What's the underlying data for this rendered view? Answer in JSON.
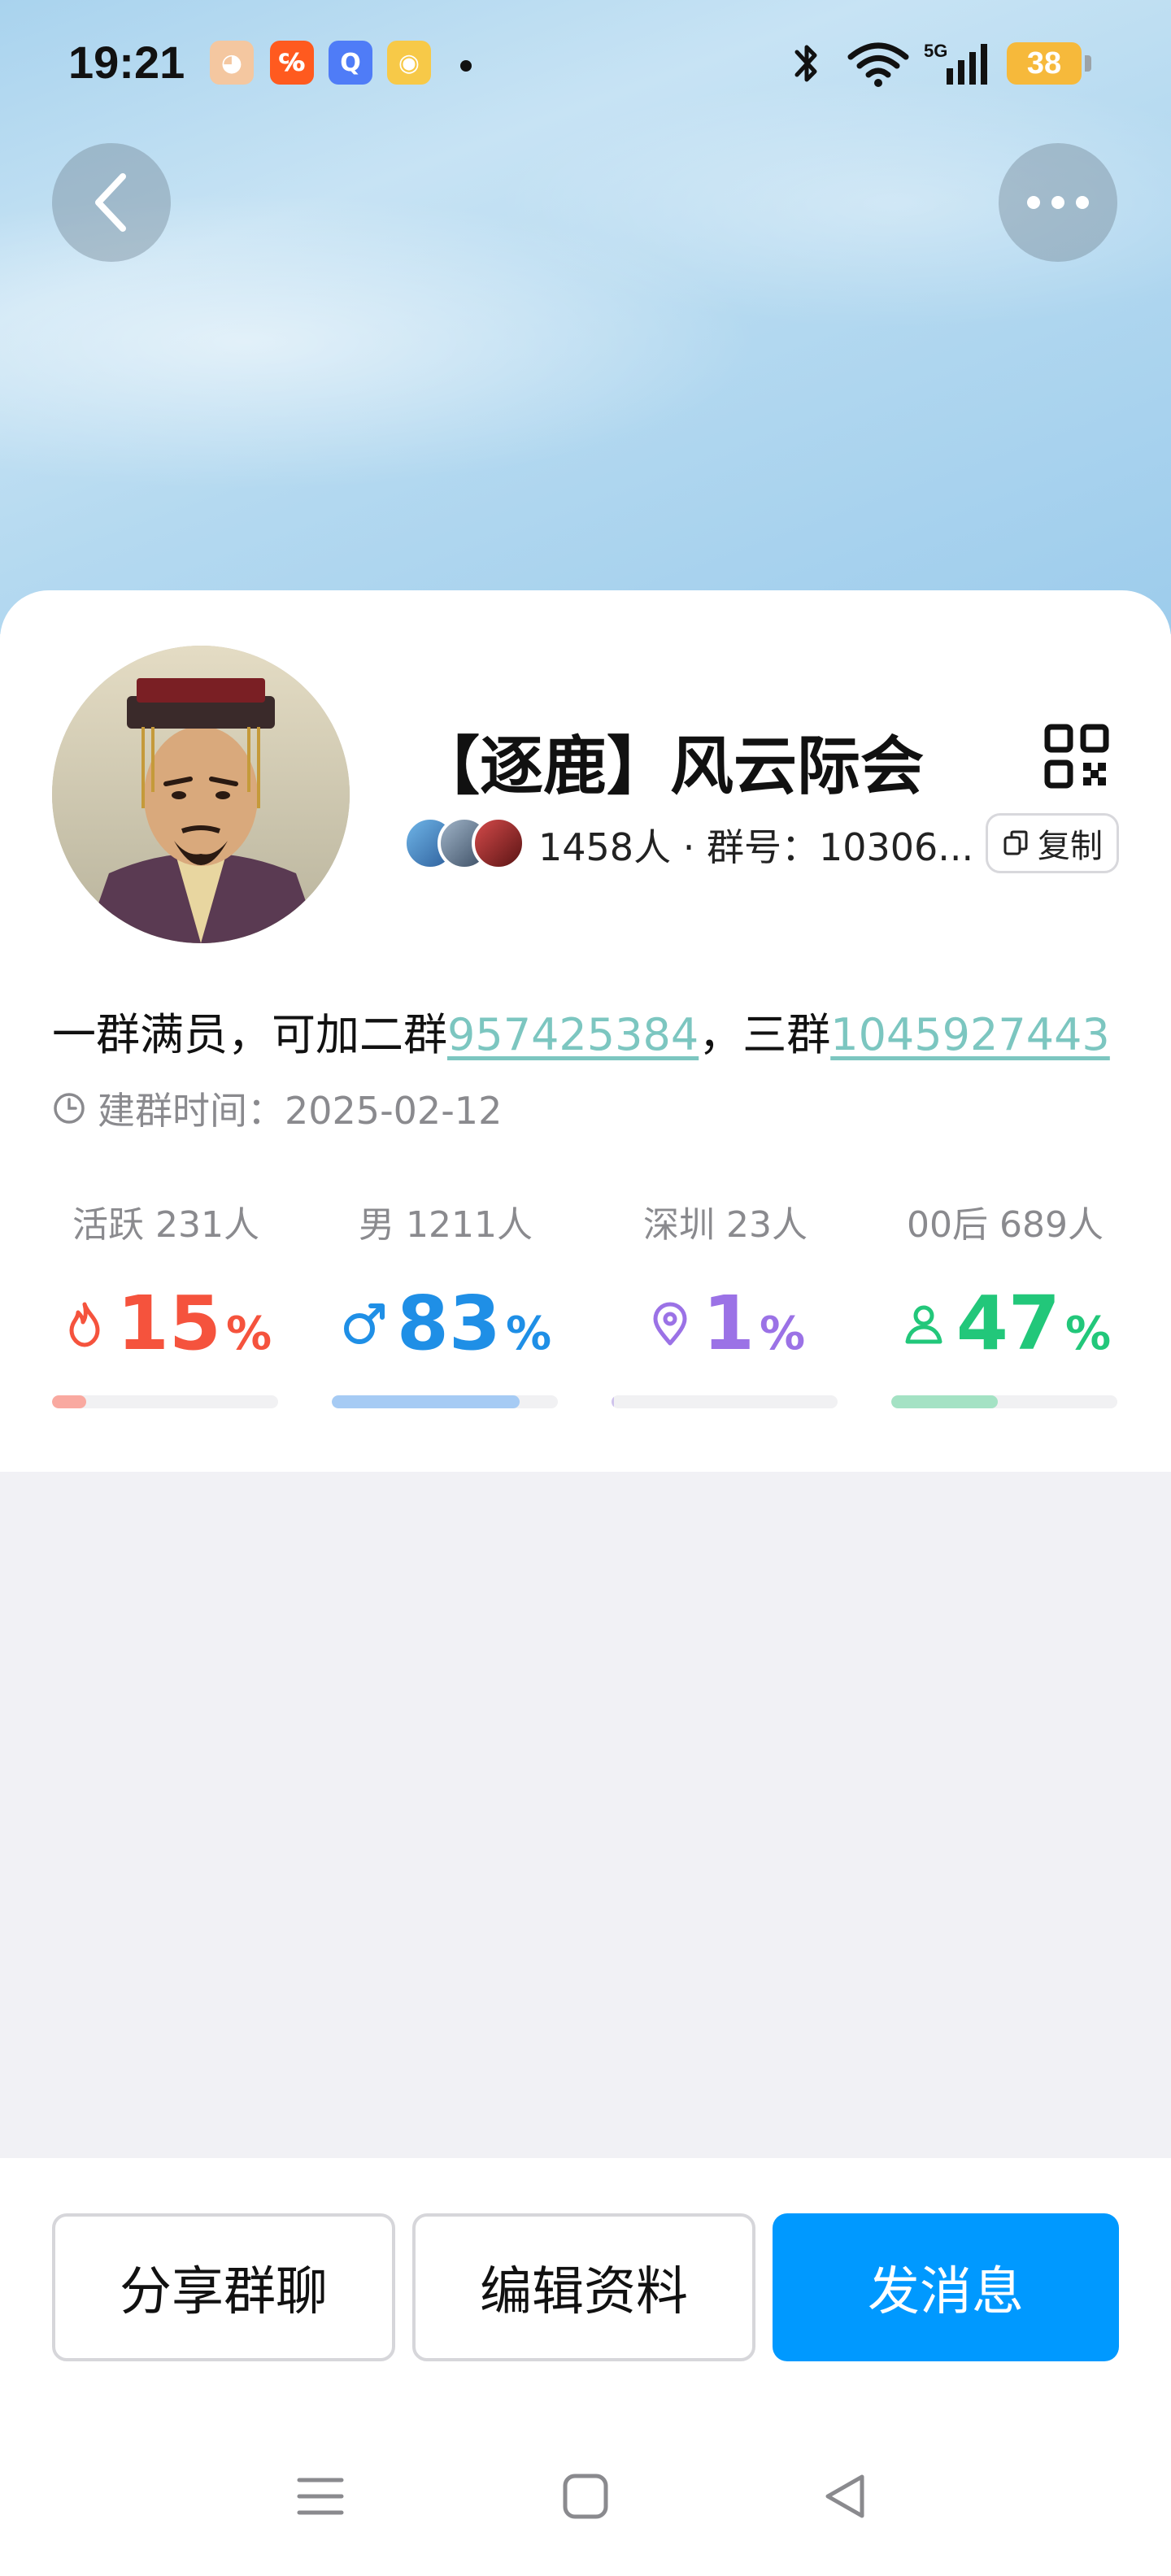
{
  "status_bar": {
    "time": "19:21",
    "battery": "38",
    "network": "5G",
    "notifications": [
      {
        "name": "app-notification-1-icon",
        "color": "#f4c7a0",
        "glyph": "◕"
      },
      {
        "name": "app-notification-2-icon",
        "color": "#ff5a1f",
        "glyph": "℅"
      },
      {
        "name": "app-notification-3-icon",
        "color": "#4f7cf7",
        "glyph": "Q"
      },
      {
        "name": "weibo-icon",
        "color": "#f7c948",
        "glyph": "◉"
      }
    ]
  },
  "header": {
    "back_icon": "chevron-left-icon",
    "more_icon": "more-horizontal-icon"
  },
  "group": {
    "name": "【逐鹿】风云际会",
    "member_count": "1458人",
    "separator": " · ",
    "group_number_label": "群号：",
    "group_number_truncated": "10306...",
    "copy_label": "复制",
    "description_prefix": "一群满员，可加二群",
    "link_group2": "957425384",
    "description_mid": "，三群",
    "link_group3": "1045927443",
    "created_label": "建群时间：",
    "created_date": "2025-02-12"
  },
  "stats": [
    {
      "label": "活跃 231人",
      "value": "15",
      "unit": "%",
      "fraction": 0.15,
      "color": "#f5533d",
      "bar_color": "#f9a9a0",
      "icon": "flame-icon"
    },
    {
      "label": "男 1211人",
      "value": "83",
      "unit": "%",
      "fraction": 0.83,
      "color": "#1f8fe6",
      "bar_color": "#a6cbf4",
      "icon": "male-icon"
    },
    {
      "label": "深圳 23人",
      "value": "1",
      "unit": "%",
      "fraction": 0.01,
      "color": "#9b72e6",
      "bar_color": "#cfc3ec",
      "icon": "location-pin-icon"
    },
    {
      "label": "00后 689人",
      "value": "47",
      "unit": "%",
      "fraction": 0.47,
      "color": "#22c77a",
      "bar_color": "#a4e2c4",
      "icon": "person-icon"
    }
  ],
  "actions": {
    "share": "分享群聊",
    "edit": "编辑资料",
    "send": "发消息"
  },
  "nav": {
    "menu_icon": "menu-icon",
    "home_icon": "home-square-icon",
    "back_icon": "back-triangle-icon"
  }
}
